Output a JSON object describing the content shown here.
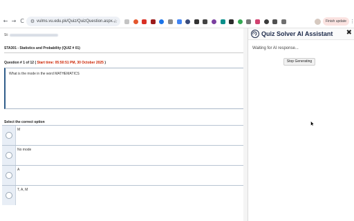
{
  "browser": {
    "url": "vulms.vu.edu.pk/Quiz/QuizQuestion.aspx...",
    "update_button": "Finish update",
    "back_icon": "←",
    "forward_icon": "→",
    "reload_icon": "C",
    "tune_icon": "⚙",
    "star_icon": "☆",
    "menu_icon": "⋮",
    "extensions": [
      {
        "name": "ext-grey",
        "color": "#c4c4c4"
      },
      {
        "name": "ext-flame",
        "color": "#e4572e"
      },
      {
        "name": "ext-red",
        "color": "#d93025"
      },
      {
        "name": "ext-dark-red",
        "color": "#9c1c1c"
      },
      {
        "name": "ext-blue",
        "color": "#1a73e8"
      },
      {
        "name": "ext-grey-2",
        "color": "#8a8a8a"
      },
      {
        "name": "ext-blue-2",
        "color": "#4285f4"
      },
      {
        "name": "ext-navy",
        "color": "#3a4b7a"
      },
      {
        "name": "ext-dark",
        "color": "#333333"
      },
      {
        "name": "ext-dark-2",
        "color": "#444444"
      },
      {
        "name": "ext-purple",
        "color": "#7b3fa0"
      },
      {
        "name": "ext-teal",
        "color": "#0b8f8a"
      },
      {
        "name": "ext-dark-3",
        "color": "#2b2b2b"
      },
      {
        "name": "ext-green",
        "color": "#34a853"
      },
      {
        "name": "ext-grey-3",
        "color": "#777777"
      },
      {
        "name": "ext-pink",
        "color": "#d1416f"
      },
      {
        "name": "ext-dark-4",
        "color": "#3b3b3b"
      },
      {
        "name": "ext-dark-5",
        "color": "#505050"
      },
      {
        "name": "ext-grey-4",
        "color": "#6f6f6f"
      }
    ]
  },
  "quiz": {
    "id_label": "St:",
    "course_title": "STA301 - Statistics and Probability (QUIZ # 01)",
    "question_number": "Question # 1 of 12 (",
    "start_time": "Start time: 05:50:51 PM, 30 October 2025",
    "question_close": ")",
    "question_text": "What is the mode in the word MATHEMATICS",
    "select_label": "Select the correct option",
    "options": [
      {
        "text": "M"
      },
      {
        "text": "No mode"
      },
      {
        "text": "A"
      },
      {
        "text": "T, A, M"
      }
    ]
  },
  "panel": {
    "title": "Quiz Solver AI Assistant",
    "close_icon": "✖",
    "status": "Waiting for AI response...",
    "stop_button": "Stop Generating"
  },
  "colors": {
    "accent_red": "#cc2200",
    "panel_title": "#1d2a4a",
    "option_border": "#b7c4d2"
  }
}
